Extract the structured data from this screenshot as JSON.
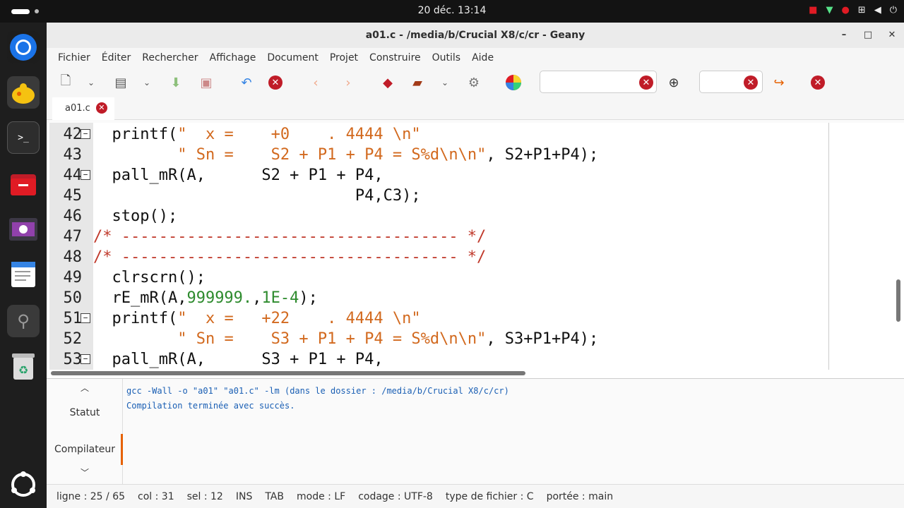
{
  "topbar": {
    "clock": "20 déc.  13:14"
  },
  "window": {
    "title": "a01.c - /media/b/Crucial X8/c/cr - Geany"
  },
  "menu": [
    "Fichier",
    "Éditer",
    "Rechercher",
    "Affichage",
    "Document",
    "Projet",
    "Construire",
    "Outils",
    "Aide"
  ],
  "tab": {
    "label": "a01.c"
  },
  "code_lines": [
    {
      "num": "42",
      "fold": true,
      "segs": [
        [
          "  printf(",
          ""
        ],
        [
          "\"  x =    +0    . 4444 \\n\"",
          "s"
        ]
      ]
    },
    {
      "num": "43",
      "fold": false,
      "segs": [
        [
          "         ",
          ""
        ],
        [
          "\" Sn =    S2 + P1 + P4 = S%d\\n\\n\"",
          "s"
        ],
        [
          ", S2+P1+P4);",
          ""
        ]
      ]
    },
    {
      "num": "44",
      "fold": true,
      "segs": [
        [
          "  pall_mR(A,      S2 + P1 + P4,",
          ""
        ]
      ]
    },
    {
      "num": "45",
      "fold": false,
      "segs": [
        [
          "                            P4,C3);",
          ""
        ]
      ]
    },
    {
      "num": "46",
      "fold": false,
      "segs": [
        [
          "  stop();",
          ""
        ]
      ]
    },
    {
      "num": "47",
      "fold": false,
      "segs": [
        [
          "/* ------------------------------------ */",
          "c"
        ]
      ]
    },
    {
      "num": "48",
      "fold": false,
      "segs": [
        [
          "/* ------------------------------------ */",
          "c"
        ]
      ]
    },
    {
      "num": "49",
      "fold": false,
      "segs": [
        [
          "  clrscrn();",
          ""
        ]
      ]
    },
    {
      "num": "50",
      "fold": false,
      "segs": [
        [
          "  rE_mR(A,",
          ""
        ],
        [
          "999999.",
          "n"
        ],
        [
          ",",
          ""
        ],
        [
          "1E-4",
          "n"
        ],
        [
          ");",
          ""
        ]
      ]
    },
    {
      "num": "51",
      "fold": true,
      "segs": [
        [
          "  printf(",
          ""
        ],
        [
          "\"  x =   +22    . 4444 \\n\"",
          "s"
        ]
      ]
    },
    {
      "num": "52",
      "fold": false,
      "segs": [
        [
          "         ",
          ""
        ],
        [
          "\" Sn =    S3 + P1 + P4 = S%d\\n\\n\"",
          "s"
        ],
        [
          ", S3+P1+P4);",
          ""
        ]
      ]
    },
    {
      "num": "53",
      "fold": true,
      "segs": [
        [
          "  pall_mR(A,      S3 + P1 + P4,",
          ""
        ]
      ]
    }
  ],
  "panel": {
    "tabs": {
      "status": "Statut",
      "compiler": "Compilateur"
    },
    "messages": [
      "gcc -Wall -o \"a01\" \"a01.c\" -lm (dans le dossier : /media/b/Crucial X8/c/cr)",
      "Compilation terminée avec succès."
    ]
  },
  "status": [
    "ligne : 25 / 65",
    "col : 31",
    "sel : 12",
    "INS",
    "TAB",
    "mode : LF",
    "codage : UTF-8",
    "type de fichier : C",
    "portée : main"
  ],
  "colors": {
    "string": "#d2691e",
    "number": "#2e8b2e",
    "comment": "#c0392b",
    "close": "#c01c28"
  }
}
